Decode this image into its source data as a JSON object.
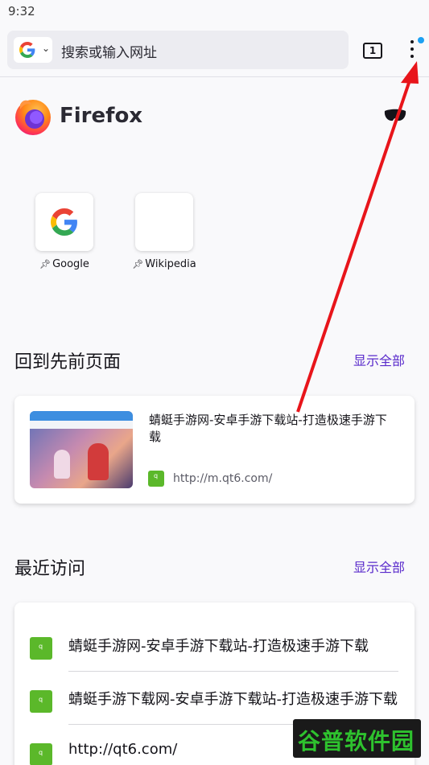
{
  "status_bar": {
    "time": "9:32"
  },
  "toolbar": {
    "search_placeholder": "搜索或输入网址",
    "tab_count": "1",
    "search_engine_icon": "google-icon",
    "menu_icon": "vertical-dots-icon"
  },
  "brand": {
    "name": "Firefox"
  },
  "shortcuts": [
    {
      "label": "Google",
      "icon": "google-logo-icon"
    },
    {
      "label": "Wikipedia",
      "icon": "blank-tile-icon"
    }
  ],
  "jump_back_in": {
    "title": "回到先前页面",
    "show_all": "显示全部",
    "item": {
      "title": "蜻蜓手游网-安卓手游下载站-打造极速手游下载",
      "url": "http://m.qt6.com/"
    }
  },
  "recently_visited": {
    "title": "最近访问",
    "show_all": "显示全部",
    "items": [
      {
        "title": "蜻蜓手游网-安卓手游下载站-打造极速手游下载"
      },
      {
        "title": "蜻蜓手游下载网-安卓手游下载站-打造极速手游下载"
      },
      {
        "title": "http://qt6.com/"
      }
    ]
  },
  "watermark": {
    "text": "谷普软件园"
  },
  "colors": {
    "accent": "#592acb",
    "annotation_arrow": "#e8151b",
    "favicon": "#5bb82a",
    "menu_badge": "#1da1f2"
  }
}
